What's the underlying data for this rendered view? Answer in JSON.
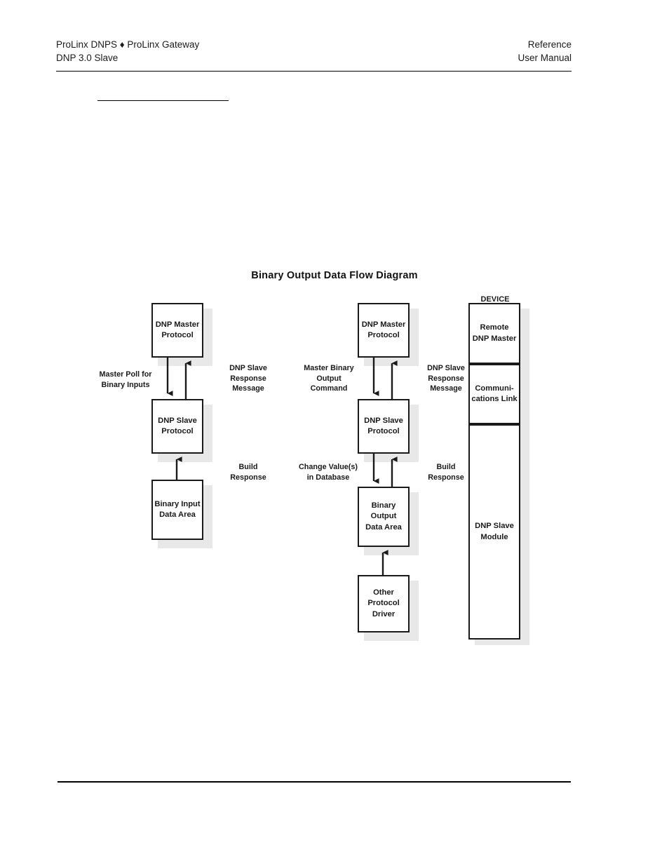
{
  "header": {
    "left_line1": "ProLinx DNPS ♦ ProLinx Gateway",
    "left_line2": "DNP 3.0 Slave",
    "right_line1": "Reference",
    "right_line2": "User Manual"
  },
  "figure": {
    "title": "Binary Output Data Flow Diagram",
    "left_column": {
      "box_top": "DNP Master\nProtocol",
      "box_middle": "DNP Slave\nProtocol",
      "box_bottom": "Binary Input\nData Area",
      "label_outer_left": "Master Poll for\nBinary Inputs",
      "label_right_upper": "DNP Slave\nResponse\nMessage",
      "label_right_lower": "Build\nResponse"
    },
    "middle_column": {
      "box_top": "DNP Master\nProtocol",
      "box_middle": "DNP Slave\nProtocol",
      "box_lower": "Binary Output\nData Area",
      "box_bottom": "Other\nProtocol\nDriver",
      "label_left_upper": "Master Binary\nOutput\nCommand",
      "label_left_lower": "Change Value(s)\nin Database",
      "label_right_upper": "DNP Slave\nResponse\nMessage",
      "label_right_lower": "Build\nResponse"
    },
    "device_column": {
      "heading": "DEVICE",
      "cell_top": "Remote\nDNP Master",
      "cell_middle": "Communi-\ncations Link",
      "cell_bottom": "DNP Slave\nModule"
    }
  },
  "colors": {
    "ink": "#1a1a1a",
    "shadow": "#e8e8e8",
    "page": "#ffffff"
  }
}
